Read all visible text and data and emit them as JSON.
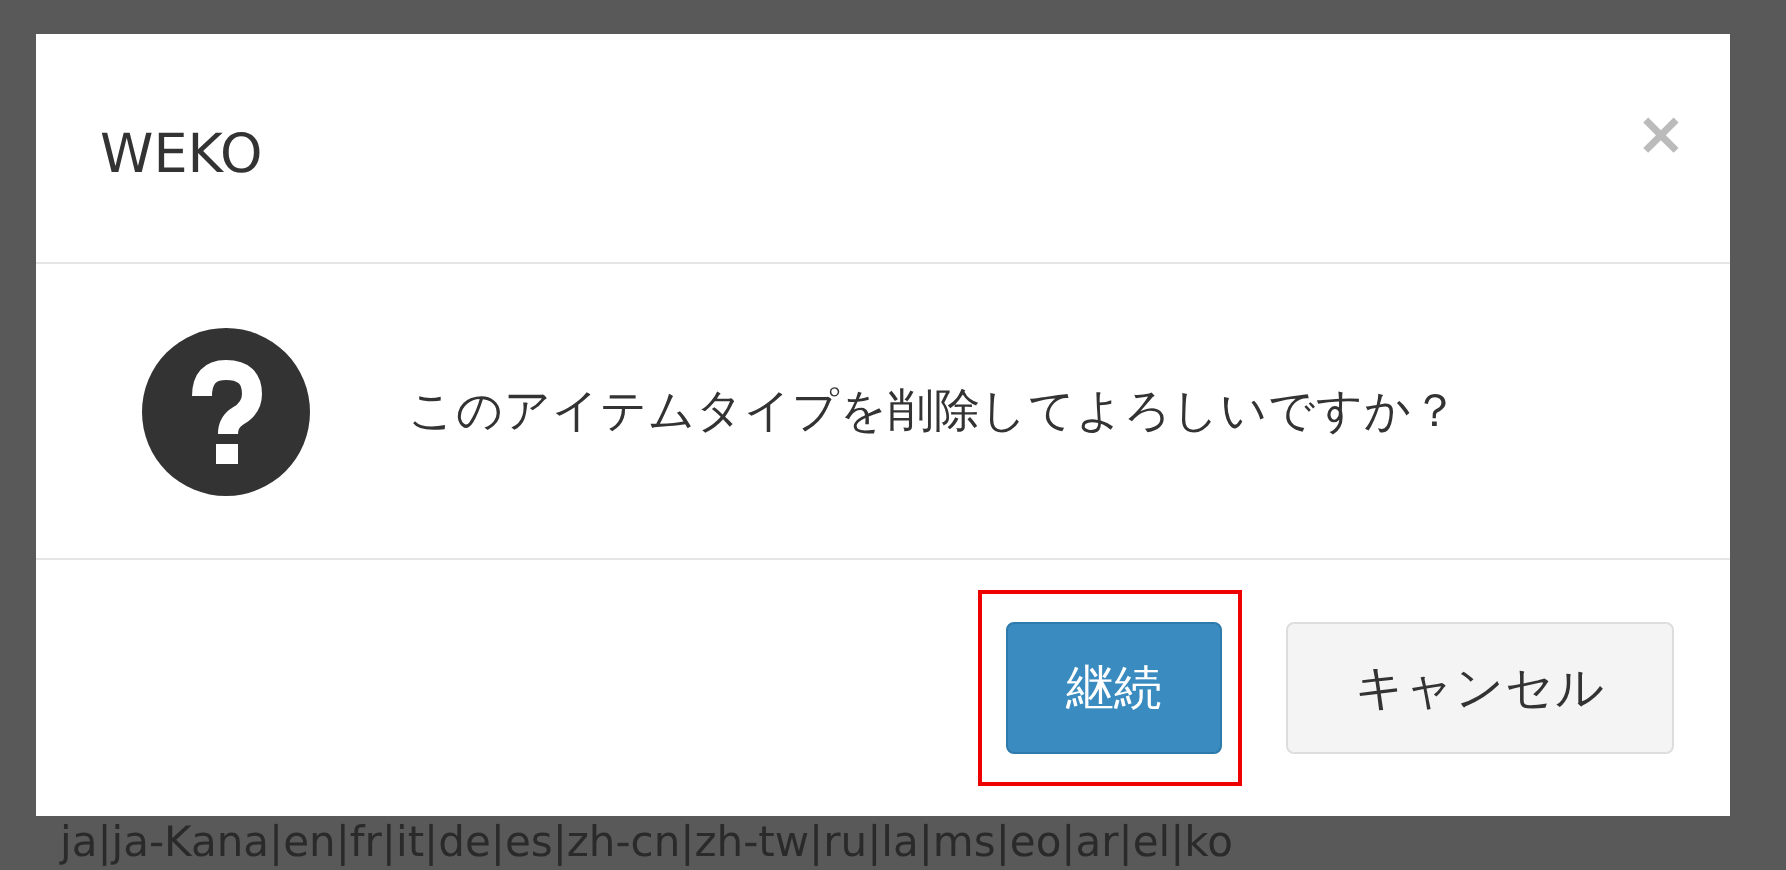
{
  "modal": {
    "title": "WEKO",
    "close": "×",
    "message": "このアイテムタイプを削除してよろしいですか？",
    "buttons": [
      {
        "label": "継続",
        "kind": "primary",
        "highlighted": true
      },
      {
        "label": "キャンセル",
        "kind": "default",
        "highlighted": false
      }
    ]
  },
  "background_text": "ja|ja-Kana|en|fr|it|de|es|zh-cn|zh-tw|ru|la|ms|eo|ar|el|ko"
}
